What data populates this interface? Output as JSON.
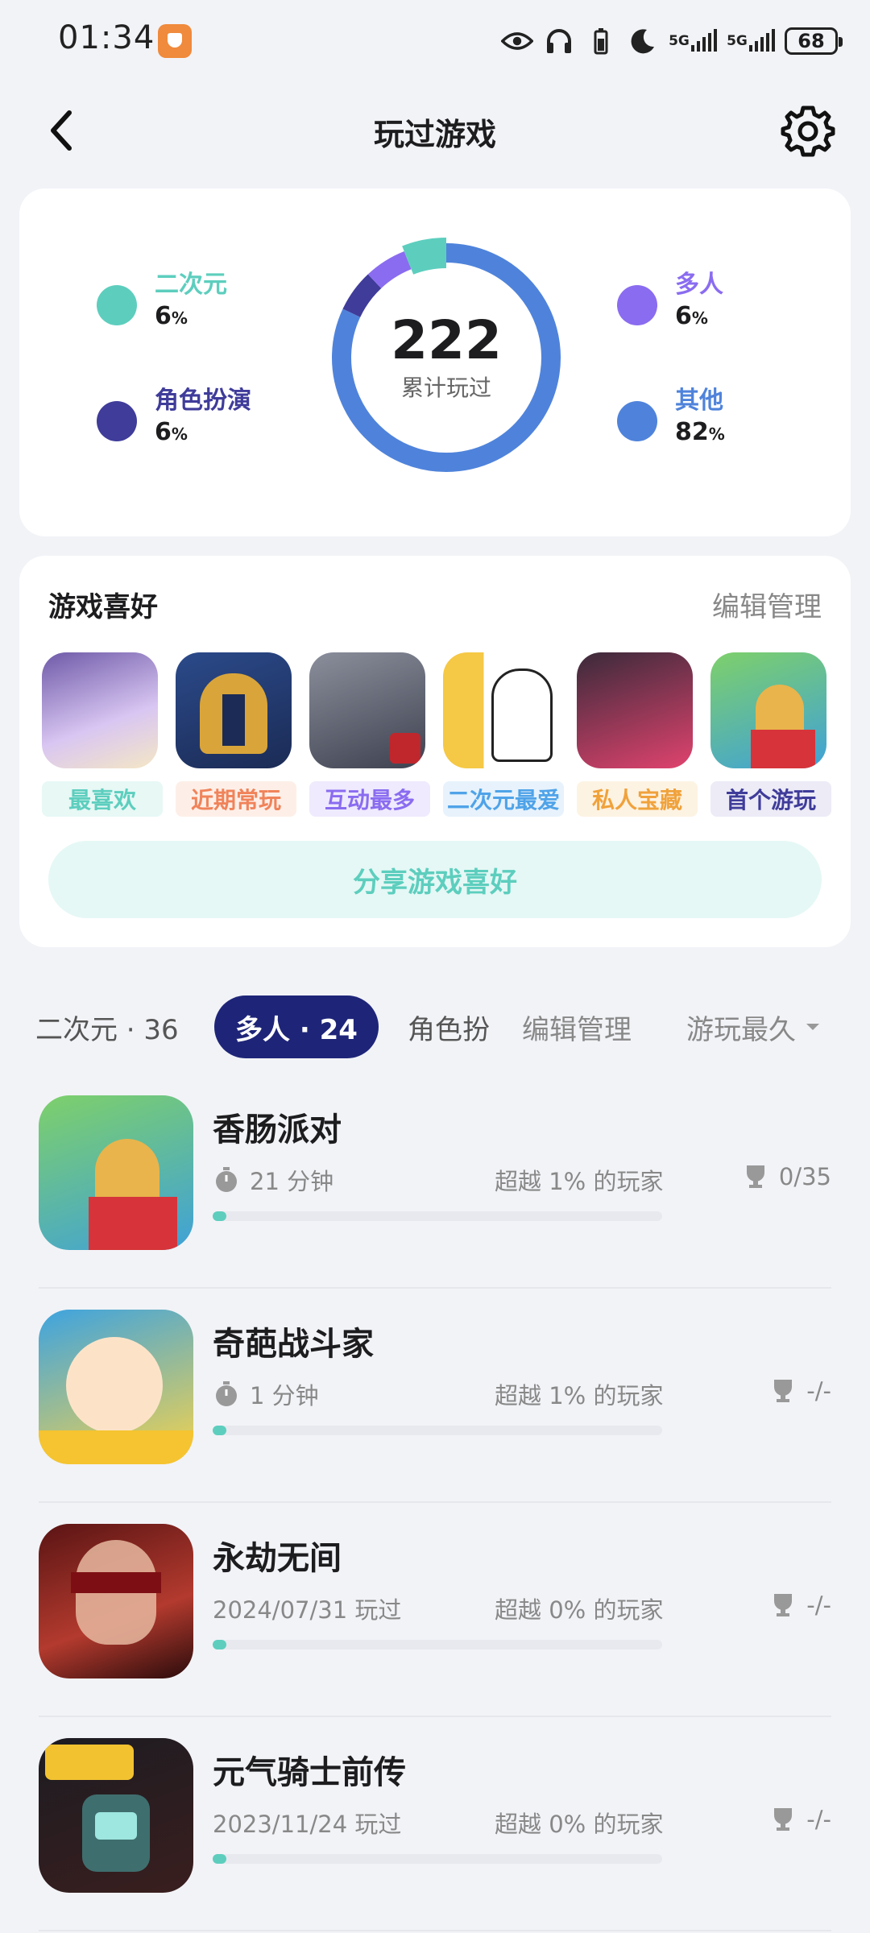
{
  "status_bar": {
    "time": "01:34",
    "network_1": "5G",
    "network_2": "5G",
    "battery": "68"
  },
  "header": {
    "title": "玩过游戏"
  },
  "summary": {
    "total": "222",
    "total_caption": "累计玩过",
    "categories": [
      {
        "label": "二次元",
        "percent": "6",
        "color": "#5DCEBE",
        "icon": "anime-icon"
      },
      {
        "label": "角色扮演",
        "percent": "6",
        "color": "#3F3C9A",
        "icon": "globe-icon"
      },
      {
        "label": "多人",
        "percent": "6",
        "color": "#8A6CF0",
        "icon": "multiplayer-icon"
      },
      {
        "label": "其他",
        "percent": "82",
        "color": "#4F83DB",
        "icon": "gamepad-icon"
      }
    ],
    "percent_sign": "%"
  },
  "preferences": {
    "title": "游戏喜好",
    "edit": "编辑管理",
    "items": [
      {
        "tag": "最喜欢",
        "color": "#5DCEBE",
        "bg": "#E7F8F5"
      },
      {
        "tag": "近期常玩",
        "color": "#F0835A",
        "bg": "#FDEFE8"
      },
      {
        "tag": "互动最多",
        "color": "#8A6CF0",
        "bg": "#EFEAFD"
      },
      {
        "tag": "二次元最爱",
        "color": "#4FA3E8",
        "bg": "#E7F2FC"
      },
      {
        "tag": "私人宝藏",
        "color": "#F0A23C",
        "bg": "#FDF3E3"
      },
      {
        "tag": "首个游玩",
        "color": "#3F3C9A",
        "bg": "#ECEBF6"
      }
    ],
    "share_label": "分享游戏喜好"
  },
  "tabs": {
    "items": [
      {
        "label": "二次元 · 36"
      },
      {
        "label": "多人 · 24"
      },
      {
        "label": "角色扮"
      }
    ],
    "edit": "编辑管理",
    "sort": "游玩最久"
  },
  "games": [
    {
      "name": "香肠派对",
      "played": "21 分钟",
      "beat": "超越 1% 的玩家",
      "trophy": "0/35",
      "progress": 0.03
    },
    {
      "name": "奇葩战斗家",
      "played": "1 分钟",
      "beat": "超越 1% 的玩家",
      "trophy": "-/-",
      "progress": 0.03
    },
    {
      "name": "永劫无间",
      "played": "2024/07/31 玩过",
      "beat": "超越 0% 的玩家",
      "trophy": "-/-",
      "progress": 0.03
    },
    {
      "name": "元气骑士前传",
      "played": "2023/11/24 玩过",
      "beat": "超越 0% 的玩家",
      "trophy": "-/-",
      "progress": 0.03
    }
  ]
}
